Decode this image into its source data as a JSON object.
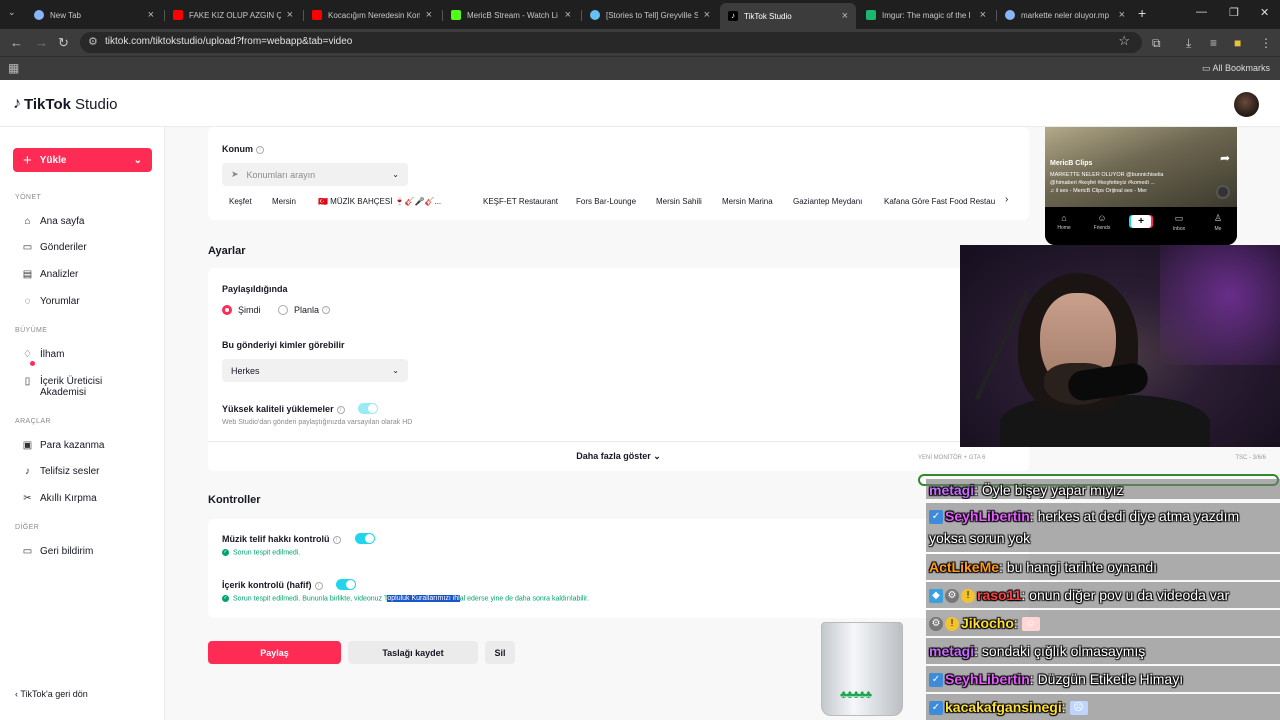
{
  "browser": {
    "tabs": [
      {
        "label": "New Tab",
        "color": "#8ab4f8"
      },
      {
        "label": "FAKE KIZ OLUP AZGIN ÇO",
        "color": "#ff0000"
      },
      {
        "label": "Kocacığım Neredesin Kon",
        "color": "#ff0000"
      },
      {
        "label": "MericB Stream - Watch Li",
        "color": "#53fc18"
      },
      {
        "label": "[Stories to Tell] Greyville S",
        "color": "#66c0f4"
      },
      {
        "label": "TikTok Studio",
        "color": "#ffffff"
      },
      {
        "label": "Imgur: The magic of the I",
        "color": "#1bb76e"
      },
      {
        "label": "markette neler oluyor.mp",
        "color": "#8ab4f8"
      }
    ],
    "url": "tiktok.com/tiktokstudio/upload?from=webapp&tab=video",
    "bookmarks_label": "All Bookmarks"
  },
  "header": {
    "logo_main": "TikTok",
    "logo_sub": "Studio"
  },
  "sidebar": {
    "upload_label": "Yükle",
    "sections": {
      "manage": "YÖNET",
      "growth": "BÜYÜME",
      "tools": "ARAÇLAR",
      "other": "DİĞER"
    },
    "items": {
      "home": "Ana sayfa",
      "posts": "Gönderiler",
      "analytics": "Analizler",
      "comments": "Yorumlar",
      "inspiration": "İlham",
      "academy": "İçerik Üreticisi Akademisi",
      "monetize": "Para kazanma",
      "royalty_free": "Telifsiz sesler",
      "smart_cut": "Akıllı Kırpma",
      "feedback": "Geri bildirim"
    },
    "back_label": "TikTok'a geri dön"
  },
  "location": {
    "label": "Konum",
    "placeholder": "Konumları arayın",
    "suggestions": [
      "Keşfet",
      "Mersin",
      "🇹🇷 MÜZİK BAHÇESİ 🍷🎸🎤🎸...",
      "KEŞF-ET Restaurant",
      "Fors Bar-Lounge",
      "Mersin Sahili",
      "Mersin Marina",
      "Gaziantep Meydanı",
      "Kafana Göre Fast Food Restau"
    ]
  },
  "settings": {
    "title": "Ayarlar",
    "when_shared_label": "Paylaşıldığında",
    "now_label": "Şimdi",
    "schedule_label": "Planla",
    "who_can_view_label": "Bu gönderiyi kimler görebilir",
    "who_can_view_value": "Herkes",
    "hq_label": "Yüksek kaliteli yüklemeler",
    "hq_hint": "Web Studio'dan gönderi paylaştığınızda varsayılan olarak HD",
    "show_more_label": "Daha fazla göster"
  },
  "controls": {
    "title": "Kontroller",
    "music_label": "Müzik telif hakkı kontrolü",
    "music_status": "Sorun tespit edilmedi.",
    "content_label": "İçerik kontrolü (hafif)",
    "content_status_a": "Sorun tespit edilmedi. Bununla birlikte, videonuz T",
    "content_status_sel": "opluluk Kurallarımızı ihl",
    "content_status_b": "al ederse yine de daha sonra kaldırılabilir."
  },
  "actions": {
    "post_label": "Paylaş",
    "draft_label": "Taslağı kaydet",
    "discard_label": "Sil"
  },
  "preview": {
    "account": "MericB Clips",
    "caption": "MARKETTE NELER OLUYOR @bunnichiselia @himaberi #keşfet #keşfetteyiz #komedi ...",
    "sound": "♫ il ses - MericB Clips   Orijinal ses - Mer",
    "nav": [
      "Home",
      "Friends",
      "Inbox",
      "Me"
    ]
  },
  "stream_overlay": {
    "strip_left": "YENİ MONİTÖR + GTA 6",
    "strip_right": "TSC - 3/6/6",
    "chat": [
      {
        "nick": "metagi",
        "text": ": Öyle bişey yapar mıyız",
        "color": "#c86cff"
      },
      {
        "nick": "SeyhLibertin",
        "text": ": herkes at dedi diye atma yazdım yoksa sorun yok",
        "color": "#e55cff"
      },
      {
        "nick": "ActLikeMe",
        "text": ": bu hangi tarihte oynandı",
        "color": "#ff9a1f"
      },
      {
        "nick": "raso11",
        "text": ": onun diğer pov u da videoda var",
        "color": "#ff4040"
      },
      {
        "nick": "Jikocho",
        "text": ":",
        "color": "#ffe033"
      },
      {
        "nick": "metagi",
        "text": ": sondaki çığlık olmasaymış",
        "color": "#c86cff"
      },
      {
        "nick": "SeyhLibertin",
        "text": ": Düzgün Etiketle Himayı",
        "color": "#e55cff"
      },
      {
        "nick": "kacakafgansinegi",
        "text": ":",
        "color": "#ffe033"
      }
    ]
  },
  "colors": {
    "accent": "#fe2c55",
    "toggle": "#20d5ec",
    "success": "#00a36c"
  }
}
